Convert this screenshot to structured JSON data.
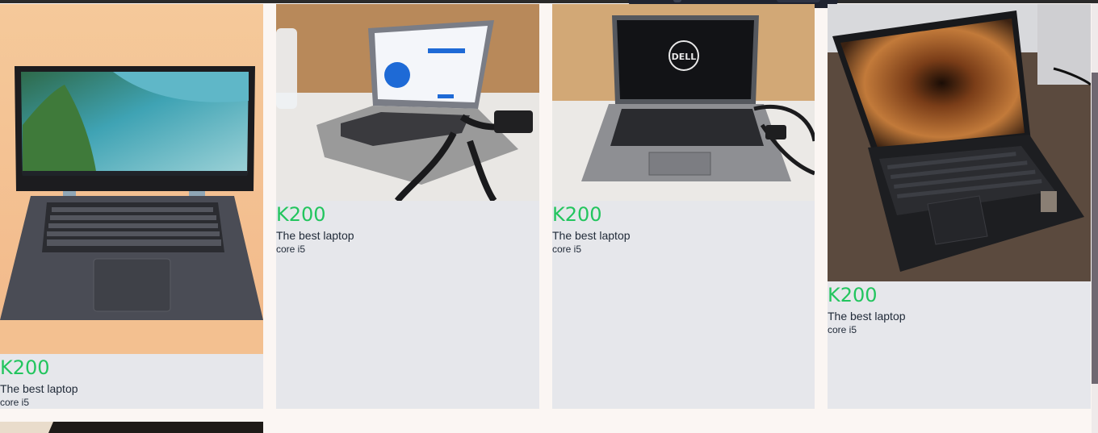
{
  "listings": [
    {
      "price": "K200",
      "title": "The best laptop",
      "spec": "core i5"
    },
    {
      "price": "K200",
      "title": "The best laptop",
      "spec": "core i5"
    },
    {
      "price": "K200",
      "title": "The best laptop",
      "spec": "core i5"
    },
    {
      "price": "K200",
      "title": "The best laptop",
      "spec": "core i5"
    }
  ],
  "brand_logo": "DELL",
  "colors": {
    "price": "#22c55e",
    "card_bg": "#e6e7eb",
    "page_bg": "#fbf6f3"
  }
}
